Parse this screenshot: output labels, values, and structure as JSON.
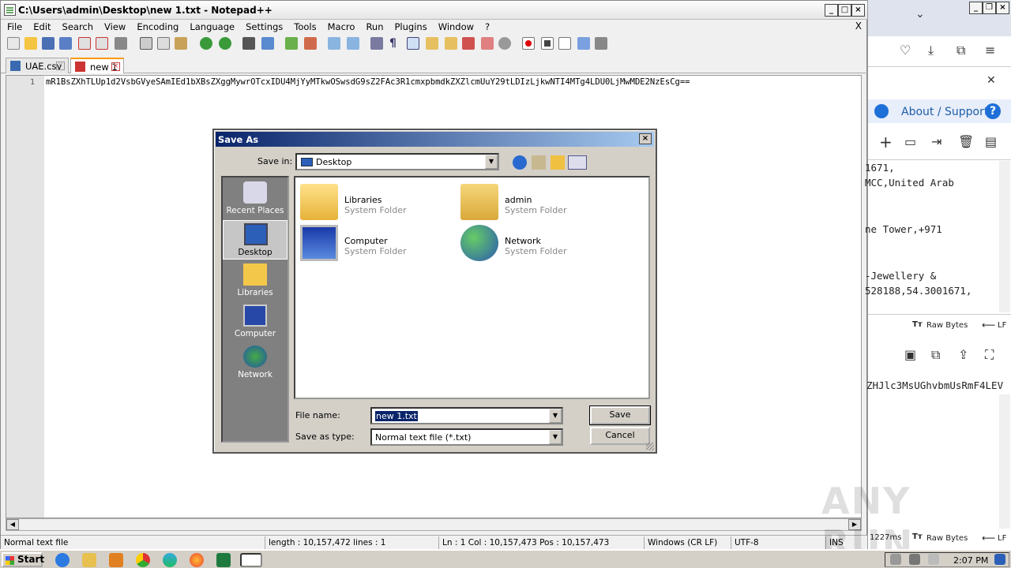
{
  "npp": {
    "title": "C:\\Users\\admin\\Desktop\\new 1.txt - Notepad++",
    "menu": [
      "File",
      "Edit",
      "Search",
      "View",
      "Encoding",
      "Language",
      "Settings",
      "Tools",
      "Macro",
      "Run",
      "Plugins",
      "Window",
      "?"
    ],
    "menu_close": "X",
    "tabs": [
      {
        "label": "UAE.csv"
      },
      {
        "label": "new 1"
      }
    ],
    "line_number": "1",
    "line_text": "mR1BsZXhTLUp1d2VsbGVyeSAmIEd1bXBsZXggMywrOTcxIDU4MjYyMTkwOSwsdG9sZ2FAc3R1cmxpbmdkZXZlcmUuY29tLDIzLjkwNTI4MTg4LDU0LjMwMDE2NzEsCg==",
    "status": {
      "type": "Normal text file",
      "length": "length : 10,157,472    lines : 1",
      "pos": "Ln : 1    Col : 10,157,473    Pos : 10,157,473",
      "eol": "Windows (CR LF)",
      "enc": "UTF-8",
      "mode": "INS"
    }
  },
  "browser": {
    "about": "About / Support",
    "help": "?",
    "lines": [
      "1671,",
      "MCC,United Arab",
      "",
      "ne Tower,+971",
      "",
      "-Jewellery &",
      "528188,54.3001671,"
    ],
    "raw_bytes_1": "Raw Bytes",
    "lf_1": "LF",
    "output_text": "ZHJlc3MsUGhvbmUsRmF4LEV",
    "timing": "1227ms",
    "raw_bytes_2": "Raw Bytes",
    "lf_2": "LF"
  },
  "dialog": {
    "title": "Save As",
    "save_in_label": "Save in:",
    "save_in_value": "Desktop",
    "places": [
      {
        "label": "Recent Places"
      },
      {
        "label": "Desktop"
      },
      {
        "label": "Libraries"
      },
      {
        "label": "Computer"
      },
      {
        "label": "Network"
      }
    ],
    "items": [
      {
        "name": "Libraries",
        "type": "System Folder"
      },
      {
        "name": "admin",
        "type": "System Folder"
      },
      {
        "name": "Computer",
        "type": "System Folder"
      },
      {
        "name": "Network",
        "type": "System Folder"
      }
    ],
    "file_name_label": "File name:",
    "file_name_value": "new 1.txt",
    "save_type_label": "Save as type:",
    "save_type_value": "Normal text file (*.txt)",
    "save_button": "Save",
    "cancel_button": "Cancel"
  },
  "taskbar": {
    "start": "Start",
    "clock": "2:07 PM"
  },
  "watermark": "ANY RUN",
  "colors": {
    "dialog_title": "#0a246a",
    "about_accent": "#1e6fd8",
    "tab_accent": "#ff9900"
  }
}
